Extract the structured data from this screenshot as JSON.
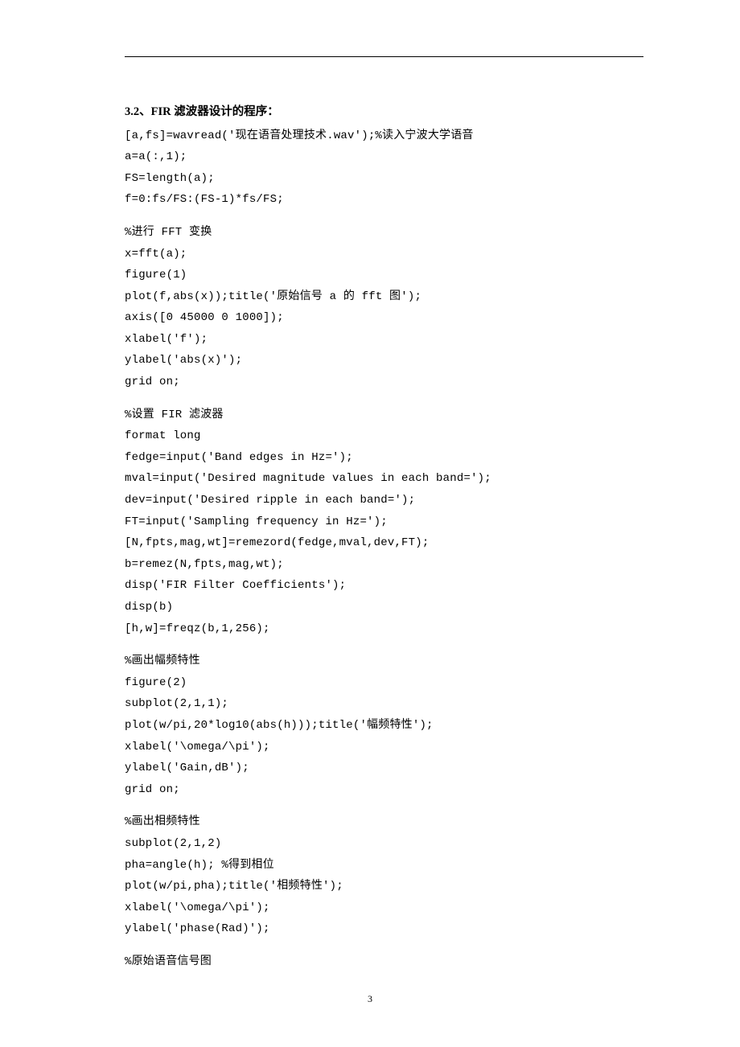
{
  "heading": "3.2、FIR 滤波器设计的程序：",
  "blocks": {
    "b1": "[a,fs]=wavread('现在语音处理技术.wav');%读入宁波大学语音\na=a(:,1);\nFS=length(a);\nf=0:fs/FS:(FS-1)*fs/FS;",
    "b2": "%进行 FFT 变换\nx=fft(a);\nfigure(1)\nplot(f,abs(x));title('原始信号 a 的 fft 图');\naxis([0 45000 0 1000]);\nxlabel('f');\nylabel('abs(x)');\ngrid on;",
    "b3": "%设置 FIR 滤波器\nformat long\nfedge=input('Band edges in Hz=');\nmval=input('Desired magnitude values in each band=');\ndev=input('Desired ripple in each band=');\nFT=input('Sampling frequency in Hz=');\n[N,fpts,mag,wt]=remezord(fedge,mval,dev,FT);\nb=remez(N,fpts,mag,wt);\ndisp('FIR Filter Coefficients');\ndisp(b)\n[h,w]=freqz(b,1,256);",
    "b4": "%画出幅频特性\nfigure(2)\nsubplot(2,1,1);\nplot(w/pi,20*log10(abs(h)));title('幅频特性');\nxlabel('\\omega/\\pi');\nylabel('Gain,dB');\ngrid on;",
    "b5": "%画出相频特性\nsubplot(2,1,2)\npha=angle(h); %得到相位\nplot(w/pi,pha);title('相频特性');\nxlabel('\\omega/\\pi');\nylabel('phase(Rad)');",
    "b6": "%原始语音信号图"
  },
  "pageNumber": "3"
}
